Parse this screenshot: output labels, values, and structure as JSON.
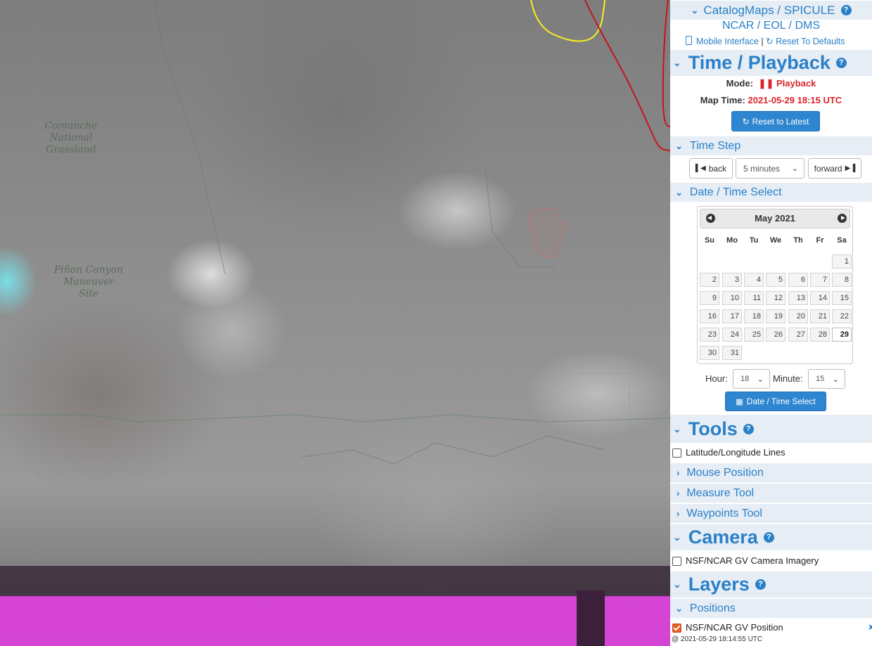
{
  "map": {
    "labels": {
      "comanche": [
        "Comanche",
        "National",
        "Grassland"
      ],
      "pinon": [
        "Piñon Canyon",
        "Maneuver",
        "Site"
      ]
    }
  },
  "header": {
    "title": "CatalogMaps / SPICULE",
    "org_links": [
      "NCAR",
      "EOL",
      "DMS"
    ],
    "mobile_link": "Mobile Interface",
    "separator": "|",
    "reset_link": "Reset To Defaults"
  },
  "time_playback": {
    "title": "Time / Playback",
    "mode_label": "Mode:",
    "mode_value": "Playback",
    "map_time_label": "Map Time:",
    "map_time_value": "2021-05-29 18:15 UTC",
    "reset_button": "Reset to Latest"
  },
  "time_step": {
    "title": "Time Step",
    "back_button": "back",
    "step_value": "5 minutes",
    "forward_button": "forward"
  },
  "date_select": {
    "title": "Date / Time Select",
    "calendar": {
      "month_label": "May 2021",
      "weekdays": [
        "Su",
        "Mo",
        "Tu",
        "We",
        "Th",
        "Fr",
        "Sa"
      ],
      "selected_day": 29
    },
    "hour_label": "Hour:",
    "hour_value": "18",
    "minute_label": "Minute:",
    "minute_value": "15",
    "submit_button": "Date / Time Select"
  },
  "tools": {
    "title": "Tools",
    "latlon_label": "Latitude/Longitude Lines",
    "mouse_position": "Mouse Position",
    "measure_tool": "Measure Tool",
    "waypoints_tool": "Waypoints Tool"
  },
  "camera": {
    "title": "Camera",
    "imagery_label": "NSF/NCAR GV Camera Imagery"
  },
  "layers": {
    "title": "Layers",
    "positions_title": "Positions",
    "gv_position_label": "NSF/NCAR GV Position",
    "gv_position_time": "@ 2021-05-29 18:14:55 UTC"
  },
  "colors": {
    "accent": "#2a80c8",
    "playback_red": "#d9262b",
    "track_yellow": "#f5f020",
    "track_red": "#c4161c",
    "band_magenta": "#e03fe0"
  }
}
